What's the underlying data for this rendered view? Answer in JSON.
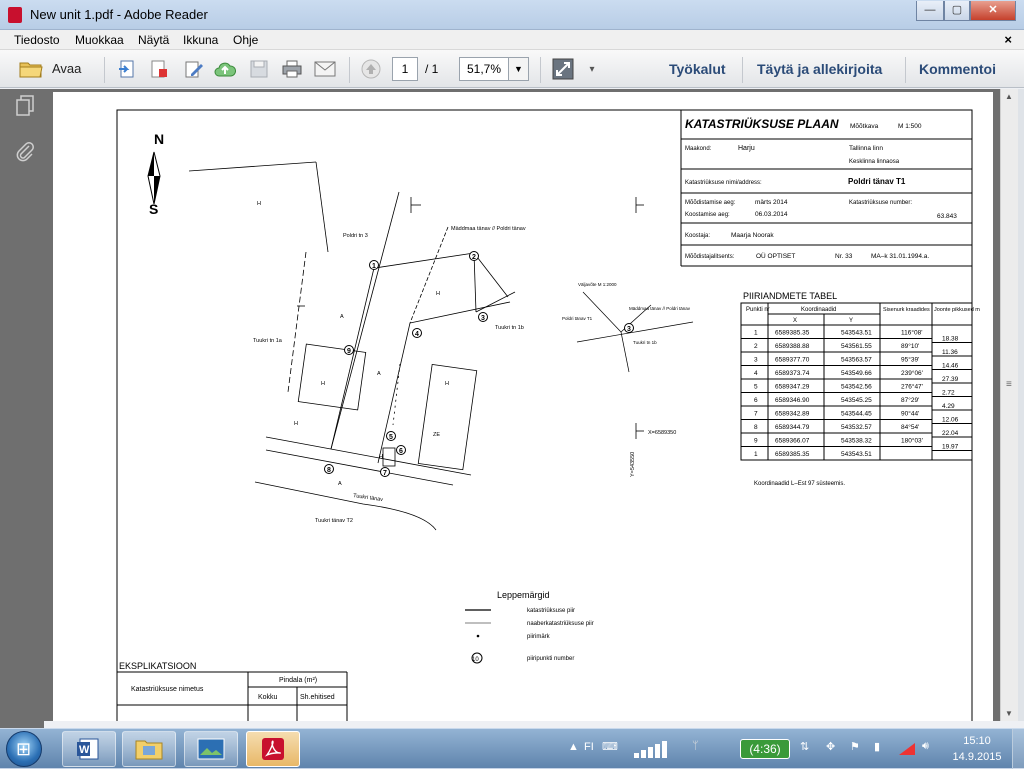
{
  "window": {
    "title": "New unit 1.pdf - Adobe Reader",
    "buttons": {
      "minimize": "—",
      "maximize": "▢",
      "close": "✕"
    }
  },
  "menu": {
    "items": [
      "Tiedosto",
      "Muokkaa",
      "Näytä",
      "Ikkuna",
      "Ohje"
    ],
    "close": "×"
  },
  "toolbar": {
    "open_label": "Avaa",
    "page_current": "1",
    "page_total": "/ 1",
    "zoom": "51,7%",
    "tools_label": "Työkalut",
    "fill_sign_label": "Täytä ja allekirjoita",
    "comment_label": "Kommentoi"
  },
  "document": {
    "north": "N",
    "south": "S",
    "plan_title": "KATASTRIÜKSUSE PLAAN",
    "scale_label": "Mõõtkava",
    "scale_value": "M    1:500",
    "county_label": "Maakond:",
    "county": "Harju",
    "city": "Tallinna linn",
    "district": "Kesklinna linnaosa",
    "unit_name_label": "Katastriüksuse nimi/address:",
    "unit_name": "Poldri tänav T1",
    "survey_date_label": "Mõõdistamise aeg:",
    "survey_date": "märts 2014",
    "compiled_label": "Koostamise aeg:",
    "compiled_date": "06.03.2014",
    "cadastral_no_label": "Katastriüksuse number:",
    "cadastral_no": "63.843",
    "author_label": "Koostaja:",
    "author": "Maarja Noorak",
    "licence_label": "Mõõdistajalitsents:",
    "licence": "OÜ OPTISET",
    "licence_no": "Nr. 33",
    "licence_date": "MA–k    31.01.1994.a.",
    "table_title": "PIIRIANDMETE TABEL",
    "table_headers": {
      "point": "Punkti nr",
      "coords": "Koordinaadid",
      "x": "X",
      "y": "Y",
      "angle": "Sisenurk kraadides",
      "length": "Joonte pikkused m"
    },
    "rows": [
      {
        "n": "1",
        "x": "6589385.35",
        "y": "543543.51",
        "a": "116°08'"
      },
      {
        "n": "2",
        "x": "6589388.88",
        "y": "543561.55",
        "a": "89°10'"
      },
      {
        "n": "3",
        "x": "6589377.70",
        "y": "543563.57",
        "a": "95°39'"
      },
      {
        "n": "4",
        "x": "6589373.74",
        "y": "543549.66",
        "a": "239°06'"
      },
      {
        "n": "5",
        "x": "6589347.29",
        "y": "543542.56",
        "a": "276°47'"
      },
      {
        "n": "6",
        "x": "6589346.90",
        "y": "543545.25",
        "a": "87°29'"
      },
      {
        "n": "7",
        "x": "6589342.89",
        "y": "543544.45",
        "a": "90°44'"
      },
      {
        "n": "8",
        "x": "6589344.79",
        "y": "543532.57",
        "a": "84°54'"
      },
      {
        "n": "9",
        "x": "6589366.07",
        "y": "543538.32",
        "a": "180°03'"
      },
      {
        "n": "1",
        "x": "6589385.35",
        "y": "543543.51",
        "a": ""
      }
    ],
    "lengths": [
      "18.38",
      "11.36",
      "14.46",
      "27.39",
      "2.72",
      "4.29",
      "12.06",
      "22.04",
      "19.97"
    ],
    "coord_note": "Koordinaadid L–Est 97 süsteemis.",
    "map_labels": {
      "poldri3": "Poldri tn 3",
      "maddmaa": "Mäddmaa tänav // Poldri tänav",
      "tuukri1a": "Tuukri tn 1a",
      "tuukri1b": "Tuukri tn 1b",
      "tuukri_tanav": "Tuukri tänav",
      "tuukri_t2": "Tuukri tänav T2",
      "x_coord": "X=6589350",
      "y_coord": "Y=543550",
      "inset_scale": "Väljavõte M 1:2000",
      "inset_street": "Mäddmaa tänav // Poldri tänav",
      "inset_poldri": "Poldri tänav T1",
      "inset_tuukri": "Tuukri tn 1b",
      "h": "H",
      "a": "A",
      "ze": "ZE"
    },
    "legend_title": "Leppemärgid",
    "legend_items": [
      "katastriüksuse piir",
      "naaberkatastriüksuse piir",
      "piirimärk",
      "piiripunkti number"
    ],
    "legend_num": "10",
    "expl_title": "EKSPLIKATSIOON",
    "expl_name": "Katastriüksuse nimetus",
    "expl_area": "Pindala  (m²)",
    "expl_total": "Kokku",
    "expl_built": "Sh.ehitised"
  },
  "taskbar": {
    "lang": "FI",
    "battery": "(4:36)",
    "time": "15:10",
    "date": "14.9.2015"
  }
}
